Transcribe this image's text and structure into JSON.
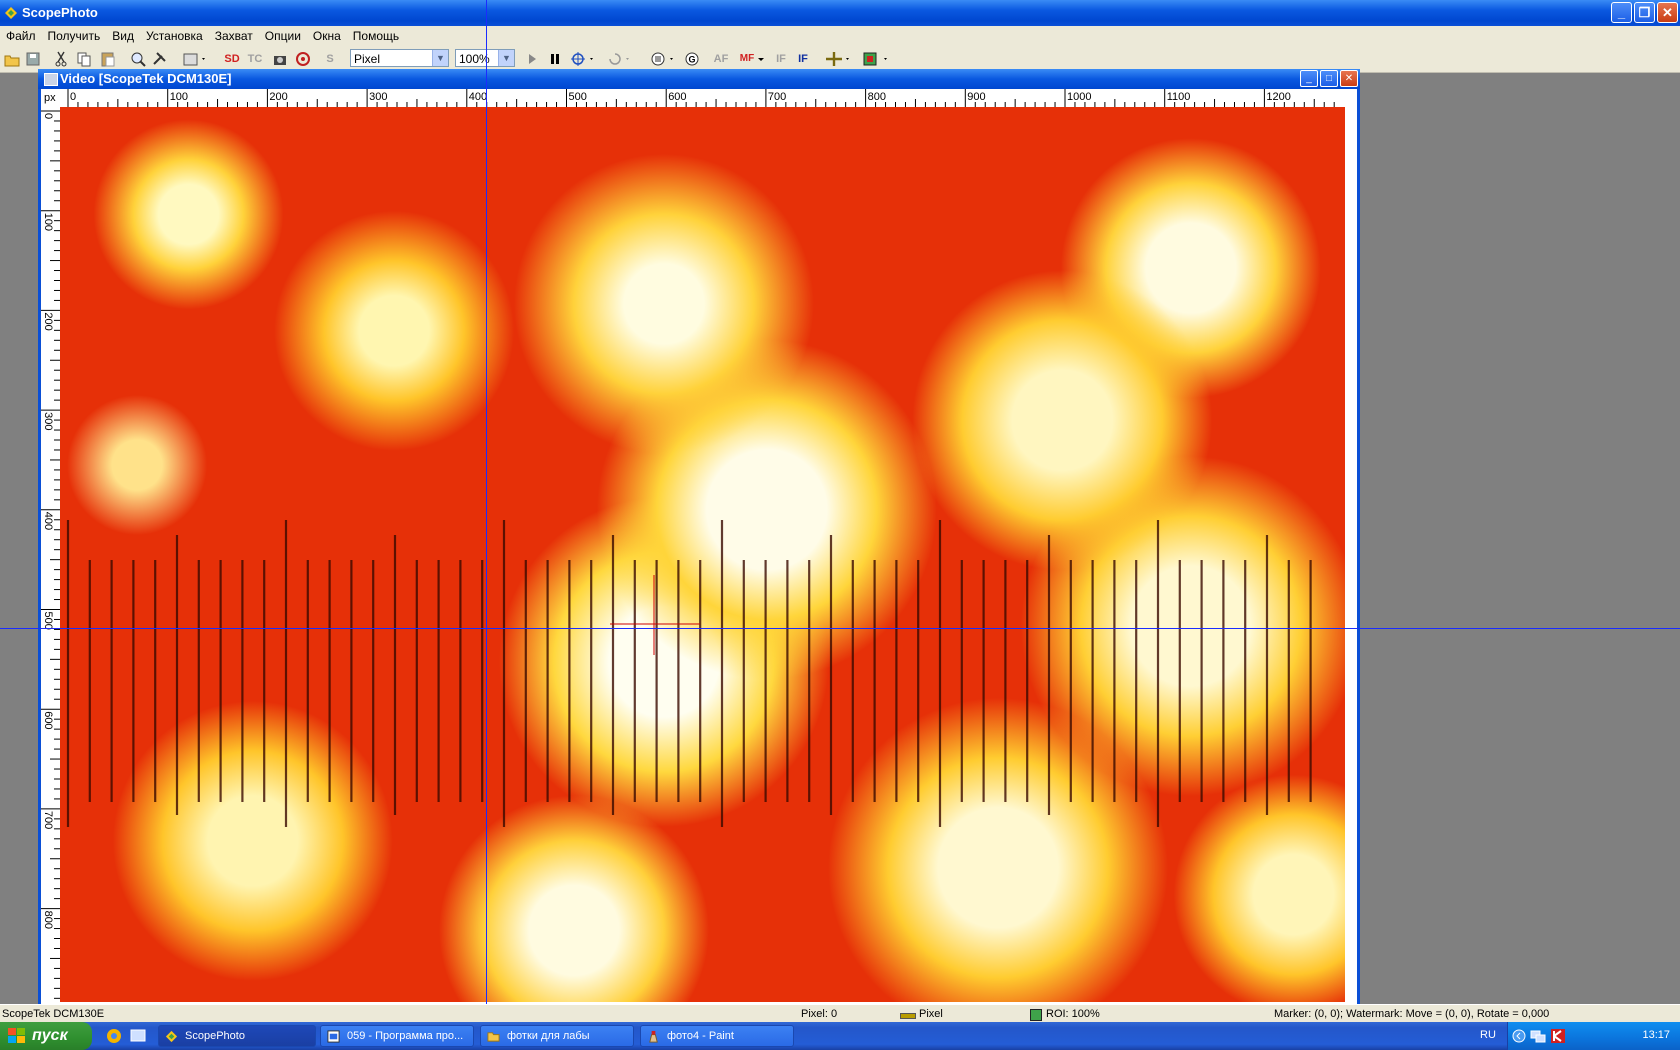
{
  "window": {
    "title": "ScopePhoto",
    "controls": [
      "_",
      "❐",
      "✕"
    ]
  },
  "menu": [
    "Файл",
    "Получить",
    "Вид",
    "Установка",
    "Захват",
    "Опции",
    "Окна",
    "Помощь"
  ],
  "toolbar": {
    "unit_select": "Pixel",
    "zoom_select": "100%",
    "sd_label": "SD",
    "tc_label": "TC",
    "s_label": "S",
    "af_label": "AF",
    "mf_label": "MF",
    "if_label": "IF",
    "if2_label": "IF"
  },
  "child": {
    "title": "Video [ScopeTek DCM130E]",
    "ruler_unit": "px",
    "ruler_top_labels": [
      "0",
      "100",
      "200",
      "300",
      "400",
      "500",
      "600",
      "700",
      "800",
      "900",
      "1000",
      "1100",
      "1200"
    ],
    "ruler_left_labels": [
      "0",
      "100",
      "200",
      "300",
      "400",
      "500",
      "600",
      "700",
      "800"
    ]
  },
  "status": {
    "device": "ScopeTek DCM130E",
    "pixel": "Pixel: 0",
    "unit": "Pixel",
    "roi": "ROI: 100%",
    "marker": "Marker: (0, 0); Watermark: Move = (0, 0), Rotate = 0,000"
  },
  "taskbar": {
    "start_label": "пуск",
    "tasks": [
      {
        "label": "ScopePhoto",
        "icon": "scopephoto-icon"
      },
      {
        "label": "059 - Программа про...",
        "icon": "document-icon"
      },
      {
        "label": "фотки для лабы",
        "icon": "folder-icon"
      },
      {
        "label": "фото4 - Paint",
        "icon": "paint-icon"
      }
    ],
    "lang": "RU",
    "clock": "13:17"
  },
  "colors": {
    "xp_blue": "#0a58e0",
    "cursor_line": "#1a2cff",
    "sample_red": "#e63008",
    "sample_yellow": "#ffd23a"
  }
}
